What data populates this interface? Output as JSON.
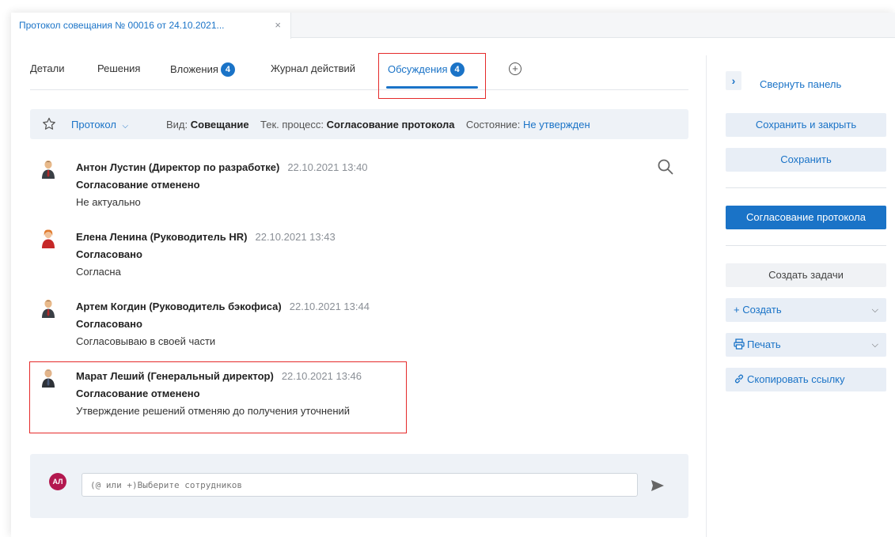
{
  "doc_tab": {
    "title": "Протокол совещания № 00016 от 24.10.2021...",
    "close": "×"
  },
  "tabs": [
    {
      "label": "Детали"
    },
    {
      "label": "Решения"
    },
    {
      "label": "Вложения",
      "count": "4"
    },
    {
      "label": "Журнал действий"
    },
    {
      "label": "Обсуждения",
      "count": "4"
    }
  ],
  "infobar": {
    "doc_type": "Протокол",
    "kind_label": "Вид:",
    "kind_value": "Совещание",
    "process_label": "Тек. процесс:",
    "process_value": "Согласование протокола",
    "state_label": "Состояние:",
    "state_value": "Не утвержден"
  },
  "comments": [
    {
      "author": "Антон Лустин (Директор по разработке)",
      "time": "22.10.2021 13:40",
      "status": "Согласование отменено",
      "text": "Не актуально",
      "avatar_color": "#3a3f45"
    },
    {
      "author": "Елена Ленина (Руководитель HR)",
      "time": "22.10.2021 13:43",
      "status": "Согласовано",
      "text": "Согласна",
      "avatar_color": "#c62828"
    },
    {
      "author": "Артем Когдин (Руководитель бэкофиса)",
      "time": "22.10.2021 13:44",
      "status": "Согласовано",
      "text": "Согласовываю в своей части",
      "avatar_color": "#3a3f45"
    },
    {
      "author": "Марат Леший (Генеральный директор)",
      "time": "22.10.2021 13:46",
      "status": "Согласование отменено",
      "text": "Утверждение решений отменяю до получения уточнений",
      "avatar_color": "#5a6470"
    }
  ],
  "composer": {
    "avatar_initials": "АЛ",
    "placeholder": "(@ или +)Выберите сотрудников"
  },
  "panel": {
    "collapse_label": "Свернуть панель",
    "save_close": "Сохранить и закрыть",
    "save": "Сохранить",
    "approve_protocol": "Согласование протокола",
    "create_tasks": "Создать задачи",
    "create": "+ Создать",
    "print": "Печать",
    "copy_link": "Скопировать ссылку"
  },
  "colors": {
    "accent": "#1a73c7",
    "highlight": "#e52a2a",
    "avatar_bg": "#b3184f"
  }
}
